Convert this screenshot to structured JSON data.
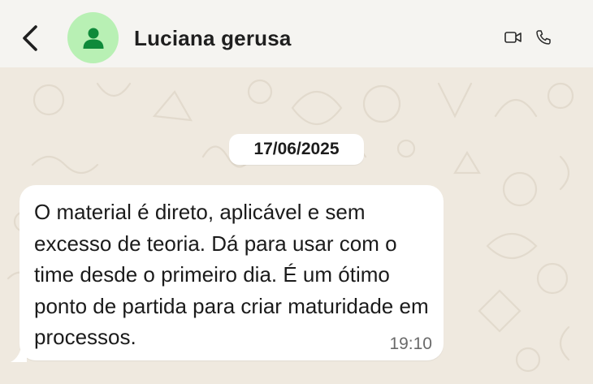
{
  "header": {
    "contact_name": "Luciana gerusa"
  },
  "icons": {
    "back": "chevron-left-icon",
    "avatar": "person-icon",
    "video": "video-camera-icon",
    "phone": "phone-icon"
  },
  "colors": {
    "avatar_bg": "#b8f0b4",
    "avatar_fg": "#0f8a3a",
    "header_bg": "#f5f4f1",
    "chat_bg": "#efe9df"
  },
  "chat": {
    "date": "17/06/2025",
    "messages": [
      {
        "text": "O material é direto, aplicável e sem excesso de teoria. Dá para usar com o time desde o primeiro dia. É um ótimo ponto de partida para criar maturidade em processos.",
        "time": "19:10"
      }
    ]
  }
}
